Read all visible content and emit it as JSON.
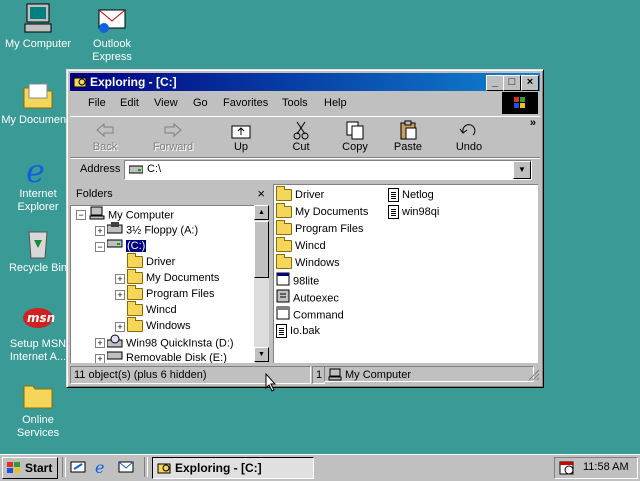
{
  "desktop": {
    "icons": [
      {
        "label": "My Computer"
      },
      {
        "label": "Outlook Express"
      },
      {
        "label": "My Documents"
      },
      {
        "label": "Internet Explorer"
      },
      {
        "label": "Recycle Bin"
      },
      {
        "label": "Setup MSN Internet A..."
      },
      {
        "label": "Online Services"
      }
    ]
  },
  "window": {
    "title": "Exploring - [C:]",
    "menu": [
      "File",
      "Edit",
      "View",
      "Go",
      "Favorites",
      "Tools",
      "Help"
    ],
    "toolbar": {
      "back": "Back",
      "forward": "Forward",
      "up": "Up",
      "cut": "Cut",
      "copy": "Copy",
      "paste": "Paste",
      "undo": "Undo",
      "more": "»"
    },
    "address": {
      "label": "Address",
      "value": "C:\\"
    },
    "folders": {
      "header": "Folders",
      "close": "×",
      "tree": [
        {
          "label": "My Computer"
        },
        {
          "label": "3½ Floppy (A:)"
        },
        {
          "label": "(C:)"
        },
        {
          "label": "Driver"
        },
        {
          "label": "My Documents"
        },
        {
          "label": "Program Files"
        },
        {
          "label": "Wincd"
        },
        {
          "label": "Windows"
        },
        {
          "label": "Win98 QuickInsta (D:)"
        },
        {
          "label": "Removable Disk (E:)"
        }
      ]
    },
    "files": {
      "col1": [
        {
          "name": "Driver",
          "icon": "folder-icon"
        },
        {
          "name": "My Documents",
          "icon": "folder-icon"
        },
        {
          "name": "Program Files",
          "icon": "folder-icon"
        },
        {
          "name": "Wincd",
          "icon": "folder-icon"
        },
        {
          "name": "Windows",
          "icon": "folder-icon"
        },
        {
          "name": "98lite",
          "icon": "app-icon"
        },
        {
          "name": "Autoexec",
          "icon": "batch-icon"
        },
        {
          "name": "Command",
          "icon": "command-icon"
        },
        {
          "name": "Io.bak",
          "icon": "document-icon"
        }
      ],
      "col2": [
        {
          "name": "Netlog",
          "icon": "document-icon"
        },
        {
          "name": "win98qi",
          "icon": "document-icon"
        }
      ]
    },
    "status": {
      "objects": "11 object(s) (plus 6 hidden)",
      "count": "1",
      "location": "My Computer"
    }
  },
  "taskbar": {
    "start": "Start",
    "task": "Exploring - [C:]",
    "clock": "11:58 AM"
  }
}
